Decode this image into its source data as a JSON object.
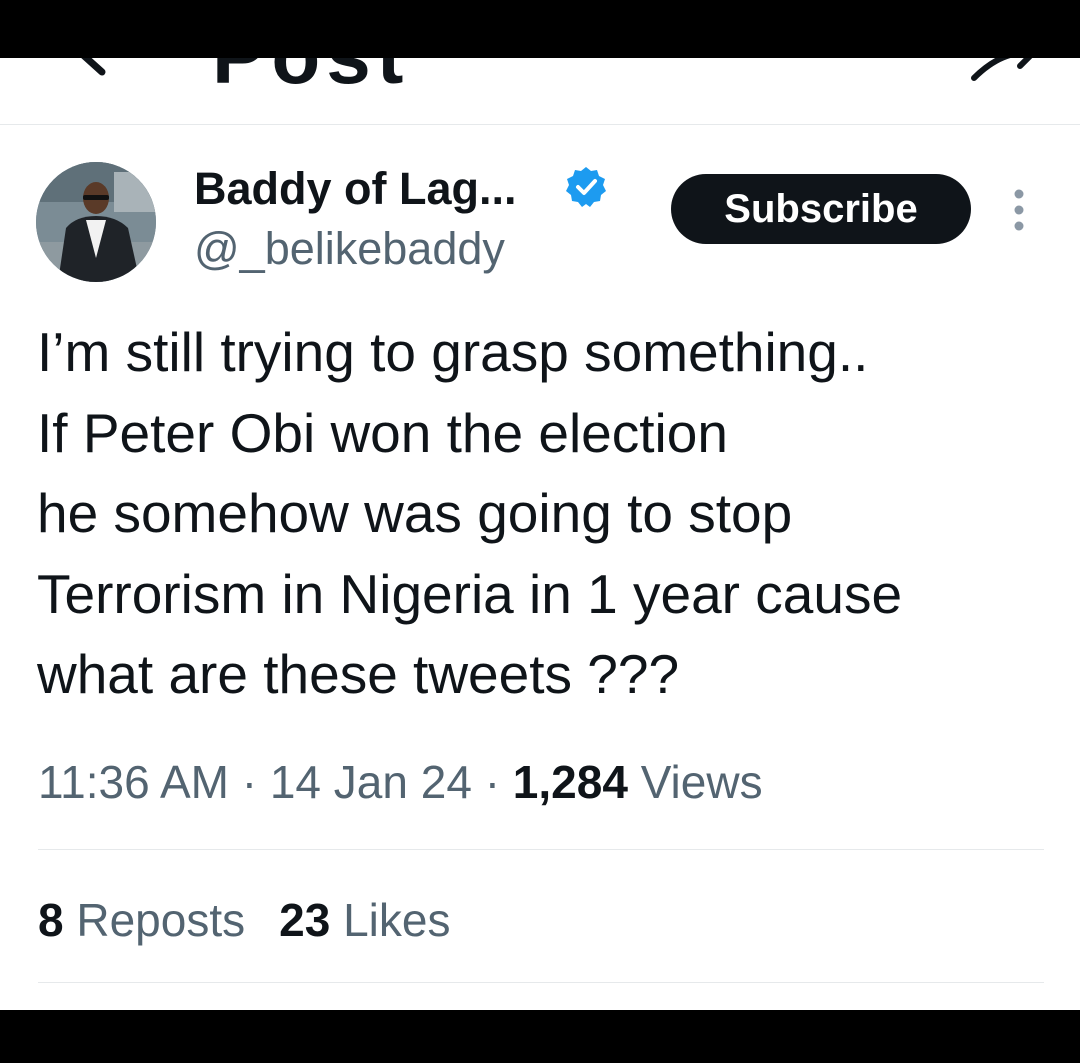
{
  "header": {
    "title": "Post",
    "back_icon": "back-arrow-icon",
    "share_icon": "share-icon"
  },
  "author": {
    "display_name": "Baddy of Lag...",
    "handle": "@_belikebaddy",
    "verified_icon": "verified-badge-icon",
    "verified_color": "#1d9bf0"
  },
  "actions": {
    "subscribe_label": "Subscribe",
    "more_icon": "more-options-icon"
  },
  "tweet": {
    "lines": [
      "I’m still trying to grasp something..",
      "If Peter Obi won the election",
      "he somehow was going to stop",
      "Terrorism in Nigeria in 1 year cause",
      "what are these tweets ???"
    ]
  },
  "meta": {
    "time": "11:36 AM",
    "separator": "·",
    "date": "14 Jan 24",
    "views_count": "1,284",
    "views_label": "Views"
  },
  "stats": {
    "reposts_count": "8",
    "reposts_label": "Reposts",
    "likes_count": "23",
    "likes_label": "Likes"
  },
  "colors": {
    "text": "#0f1419",
    "secondary": "#536471",
    "button_bg": "#0f1419",
    "bars": "#000000"
  }
}
